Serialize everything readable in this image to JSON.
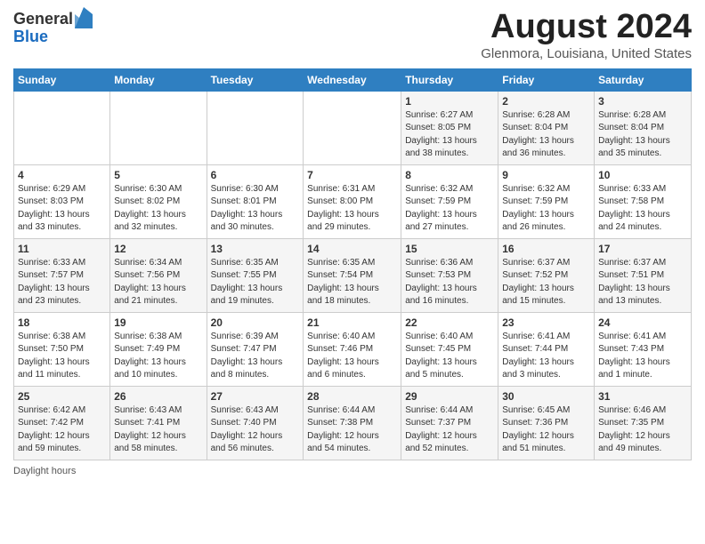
{
  "header": {
    "logo_general": "General",
    "logo_blue": "Blue",
    "month_year": "August 2024",
    "location": "Glenmora, Louisiana, United States"
  },
  "days_of_week": [
    "Sunday",
    "Monday",
    "Tuesday",
    "Wednesday",
    "Thursday",
    "Friday",
    "Saturday"
  ],
  "weeks": [
    [
      {
        "day": "",
        "info": ""
      },
      {
        "day": "",
        "info": ""
      },
      {
        "day": "",
        "info": ""
      },
      {
        "day": "",
        "info": ""
      },
      {
        "day": "1",
        "info": "Sunrise: 6:27 AM\nSunset: 8:05 PM\nDaylight: 13 hours\nand 38 minutes."
      },
      {
        "day": "2",
        "info": "Sunrise: 6:28 AM\nSunset: 8:04 PM\nDaylight: 13 hours\nand 36 minutes."
      },
      {
        "day": "3",
        "info": "Sunrise: 6:28 AM\nSunset: 8:04 PM\nDaylight: 13 hours\nand 35 minutes."
      }
    ],
    [
      {
        "day": "4",
        "info": "Sunrise: 6:29 AM\nSunset: 8:03 PM\nDaylight: 13 hours\nand 33 minutes."
      },
      {
        "day": "5",
        "info": "Sunrise: 6:30 AM\nSunset: 8:02 PM\nDaylight: 13 hours\nand 32 minutes."
      },
      {
        "day": "6",
        "info": "Sunrise: 6:30 AM\nSunset: 8:01 PM\nDaylight: 13 hours\nand 30 minutes."
      },
      {
        "day": "7",
        "info": "Sunrise: 6:31 AM\nSunset: 8:00 PM\nDaylight: 13 hours\nand 29 minutes."
      },
      {
        "day": "8",
        "info": "Sunrise: 6:32 AM\nSunset: 7:59 PM\nDaylight: 13 hours\nand 27 minutes."
      },
      {
        "day": "9",
        "info": "Sunrise: 6:32 AM\nSunset: 7:59 PM\nDaylight: 13 hours\nand 26 minutes."
      },
      {
        "day": "10",
        "info": "Sunrise: 6:33 AM\nSunset: 7:58 PM\nDaylight: 13 hours\nand 24 minutes."
      }
    ],
    [
      {
        "day": "11",
        "info": "Sunrise: 6:33 AM\nSunset: 7:57 PM\nDaylight: 13 hours\nand 23 minutes."
      },
      {
        "day": "12",
        "info": "Sunrise: 6:34 AM\nSunset: 7:56 PM\nDaylight: 13 hours\nand 21 minutes."
      },
      {
        "day": "13",
        "info": "Sunrise: 6:35 AM\nSunset: 7:55 PM\nDaylight: 13 hours\nand 19 minutes."
      },
      {
        "day": "14",
        "info": "Sunrise: 6:35 AM\nSunset: 7:54 PM\nDaylight: 13 hours\nand 18 minutes."
      },
      {
        "day": "15",
        "info": "Sunrise: 6:36 AM\nSunset: 7:53 PM\nDaylight: 13 hours\nand 16 minutes."
      },
      {
        "day": "16",
        "info": "Sunrise: 6:37 AM\nSunset: 7:52 PM\nDaylight: 13 hours\nand 15 minutes."
      },
      {
        "day": "17",
        "info": "Sunrise: 6:37 AM\nSunset: 7:51 PM\nDaylight: 13 hours\nand 13 minutes."
      }
    ],
    [
      {
        "day": "18",
        "info": "Sunrise: 6:38 AM\nSunset: 7:50 PM\nDaylight: 13 hours\nand 11 minutes."
      },
      {
        "day": "19",
        "info": "Sunrise: 6:38 AM\nSunset: 7:49 PM\nDaylight: 13 hours\nand 10 minutes."
      },
      {
        "day": "20",
        "info": "Sunrise: 6:39 AM\nSunset: 7:47 PM\nDaylight: 13 hours\nand 8 minutes."
      },
      {
        "day": "21",
        "info": "Sunrise: 6:40 AM\nSunset: 7:46 PM\nDaylight: 13 hours\nand 6 minutes."
      },
      {
        "day": "22",
        "info": "Sunrise: 6:40 AM\nSunset: 7:45 PM\nDaylight: 13 hours\nand 5 minutes."
      },
      {
        "day": "23",
        "info": "Sunrise: 6:41 AM\nSunset: 7:44 PM\nDaylight: 13 hours\nand 3 minutes."
      },
      {
        "day": "24",
        "info": "Sunrise: 6:41 AM\nSunset: 7:43 PM\nDaylight: 13 hours\nand 1 minute."
      }
    ],
    [
      {
        "day": "25",
        "info": "Sunrise: 6:42 AM\nSunset: 7:42 PM\nDaylight: 12 hours\nand 59 minutes."
      },
      {
        "day": "26",
        "info": "Sunrise: 6:43 AM\nSunset: 7:41 PM\nDaylight: 12 hours\nand 58 minutes."
      },
      {
        "day": "27",
        "info": "Sunrise: 6:43 AM\nSunset: 7:40 PM\nDaylight: 12 hours\nand 56 minutes."
      },
      {
        "day": "28",
        "info": "Sunrise: 6:44 AM\nSunset: 7:38 PM\nDaylight: 12 hours\nand 54 minutes."
      },
      {
        "day": "29",
        "info": "Sunrise: 6:44 AM\nSunset: 7:37 PM\nDaylight: 12 hours\nand 52 minutes."
      },
      {
        "day": "30",
        "info": "Sunrise: 6:45 AM\nSunset: 7:36 PM\nDaylight: 12 hours\nand 51 minutes."
      },
      {
        "day": "31",
        "info": "Sunrise: 6:46 AM\nSunset: 7:35 PM\nDaylight: 12 hours\nand 49 minutes."
      }
    ]
  ],
  "footer": {
    "daylight_label": "Daylight hours"
  }
}
